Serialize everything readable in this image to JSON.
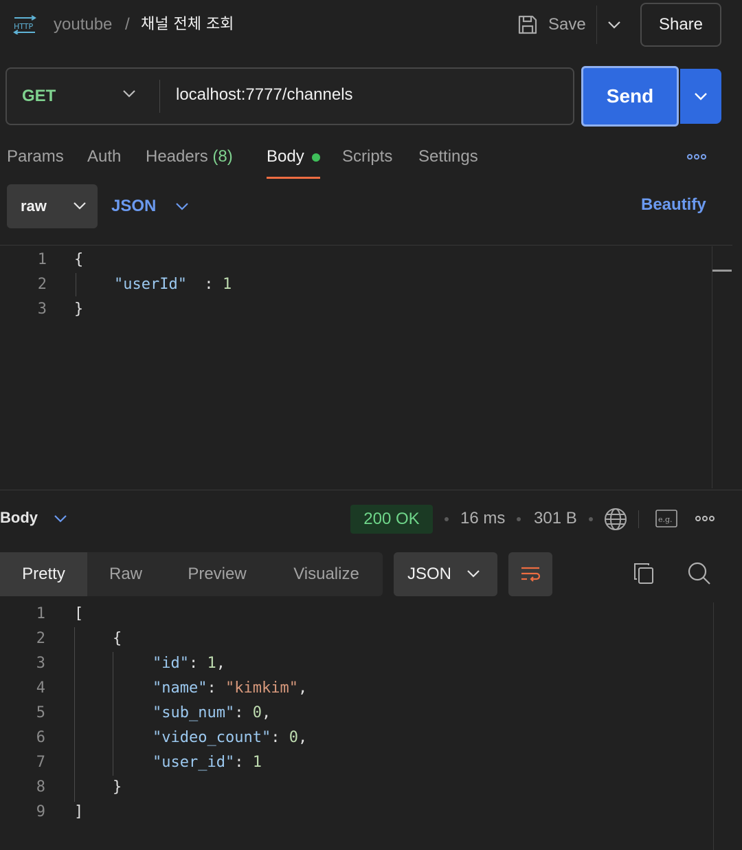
{
  "header": {
    "http_icon": "http-icon",
    "collection": "youtube",
    "separator": "/",
    "request_name": "채널 전체 조회",
    "save_label": "Save",
    "share_label": "Share"
  },
  "request": {
    "method": "GET",
    "url": "localhost:7777/channels",
    "send_label": "Send"
  },
  "request_tabs": {
    "params": "Params",
    "auth": "Auth",
    "headers": "Headers",
    "headers_count": "(8)",
    "body": "Body",
    "scripts": "Scripts",
    "settings": "Settings"
  },
  "body_options": {
    "mode": "raw",
    "language": "JSON",
    "beautify": "Beautify"
  },
  "request_body": {
    "line_numbers": [
      "1",
      "2",
      "3"
    ],
    "open_brace": "{",
    "key": "\"userId\"",
    "colon": " : ",
    "value": "1",
    "close_brace": "}"
  },
  "response": {
    "section_label": "Body",
    "status": "200 OK",
    "time": "16 ms",
    "size": "301 B",
    "example_icon": "e.g.",
    "tabs": [
      "Pretty",
      "Raw",
      "Preview",
      "Visualize"
    ],
    "active_tab": "Pretty",
    "format": "JSON",
    "line_numbers": [
      "1",
      "2",
      "3",
      "4",
      "5",
      "6",
      "7",
      "8",
      "9"
    ],
    "open_bracket": "[",
    "open_brace": "{",
    "fields": [
      {
        "key": "\"id\"",
        "value": "1",
        "type": "num",
        "comma": ","
      },
      {
        "key": "\"name\"",
        "value": "\"kimkim\"",
        "type": "str",
        "comma": ","
      },
      {
        "key": "\"sub_num\"",
        "value": "0",
        "type": "num",
        "comma": ","
      },
      {
        "key": "\"video_count\"",
        "value": "0",
        "type": "num",
        "comma": ","
      },
      {
        "key": "\"user_id\"",
        "value": "1",
        "type": "num",
        "comma": ""
      }
    ],
    "close_brace": "}",
    "close_bracket": "]"
  },
  "colors": {
    "accent_blue": "#2f6ae0",
    "method_green": "#7fd28f",
    "status_green": "#6fd68a",
    "tab_underline": "#ee6d42"
  }
}
